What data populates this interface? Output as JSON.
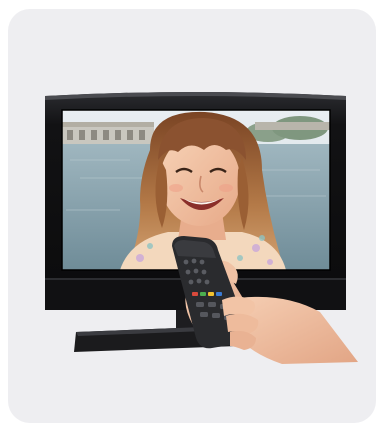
{
  "image": {
    "subject": "",
    "icons": {
      "tv": "television-icon",
      "remote": "remote-control-icon",
      "hand": "hand-icon"
    }
  },
  "colors": {
    "card_background": "#eeeef1",
    "tv_frame": "#141416",
    "tv_stand": "#1b1b1d",
    "screen_sky": "#dfe8ee",
    "screen_water": "#8aa3ad",
    "hair": "#a8683a",
    "skin": "#f4c6a6",
    "shirt_pattern": "#f2d4b4",
    "remote_body": "#2a2b2e"
  }
}
